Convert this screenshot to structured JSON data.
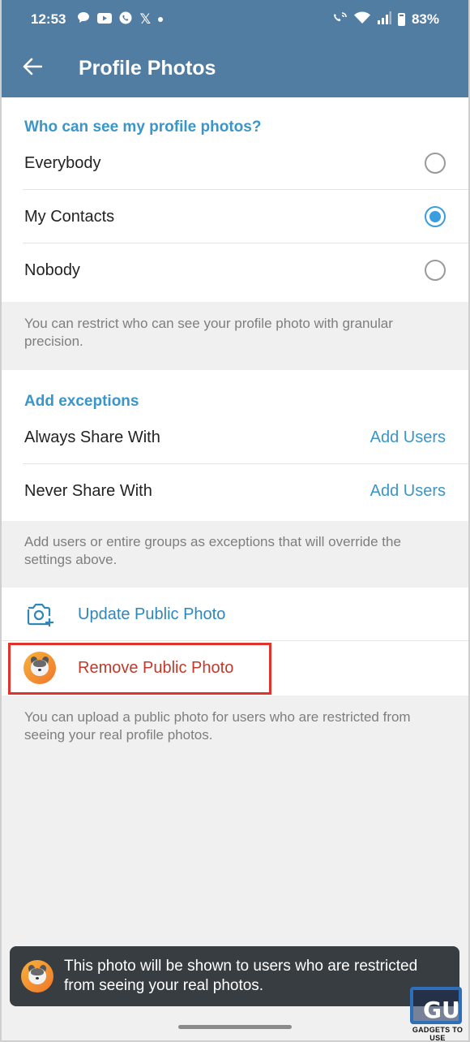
{
  "status_bar": {
    "time": "12:53",
    "battery": "83%",
    "left_icons": [
      "chat-bubble-icon",
      "youtube-icon",
      "phone-app-icon",
      "x-icon",
      "dot-icon"
    ],
    "x_glyph": "𝕏",
    "right_icons": [
      "wifi-calling-icon",
      "wifi-icon",
      "signal-icon",
      "battery-icon"
    ]
  },
  "app_bar": {
    "title": "Profile Photos",
    "back_icon": "arrow-left-icon"
  },
  "visibility": {
    "header": "Who can see my profile photos?",
    "options": [
      {
        "label": "Everybody",
        "selected": false
      },
      {
        "label": "My Contacts",
        "selected": true
      },
      {
        "label": "Nobody",
        "selected": false
      }
    ],
    "note": "You can restrict who can see your profile photo with granular precision."
  },
  "exceptions": {
    "header": "Add exceptions",
    "always_label": "Always Share With",
    "always_action": "Add Users",
    "never_label": "Never Share With",
    "never_action": "Add Users",
    "note": "Add users or entire groups as exceptions that will override the settings above."
  },
  "public_photo": {
    "update_label": "Update Public Photo",
    "remove_label": "Remove Public Photo",
    "note": "You can upload a public photo for users who are restricted from seeing your real profile photos."
  },
  "toast": {
    "message": "This photo will be shown to users who are restricted from seeing your real photos."
  },
  "watermark": {
    "logo_text": "GU",
    "caption": "GADGETS TO USE"
  },
  "colors": {
    "header_bar": "#527da3",
    "accent_blue": "#3a95c9",
    "radio_selected": "#3a9de0",
    "danger_red": "#c0392b",
    "highlight_border": "#e0332c",
    "toast_bg": "#383d42",
    "background": "#f0f0f0"
  }
}
